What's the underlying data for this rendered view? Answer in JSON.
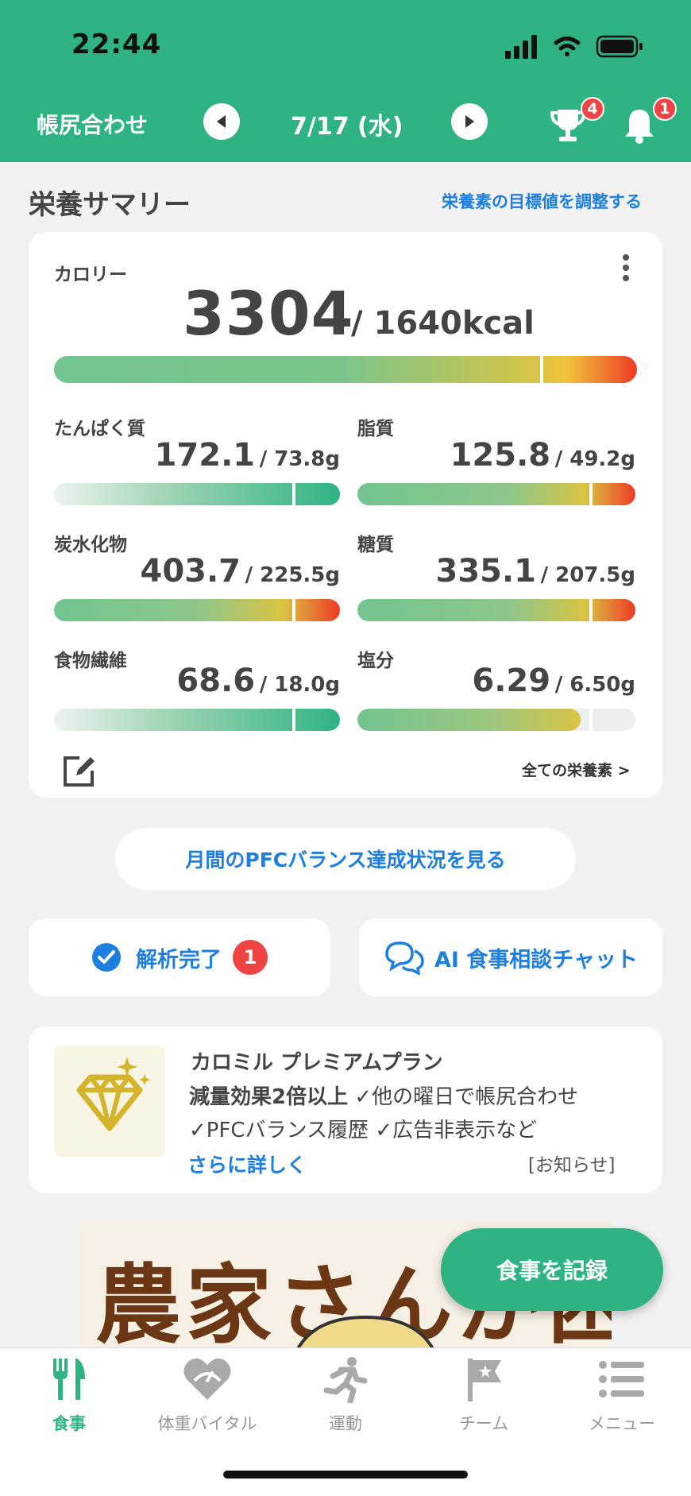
{
  "status": {
    "time": "22:44"
  },
  "nav": {
    "title": "帳尻合わせ",
    "date": "7/17 (水)",
    "trophy_badge": "4",
    "bell_badge": "1"
  },
  "summary": {
    "title": "栄養サマリー",
    "adjust_link": "栄養素の目標値を調整する"
  },
  "calorie": {
    "label": "カロリー",
    "value": "3304",
    "target": "/ 1640kcal"
  },
  "nutrients": [
    {
      "label": "たんぱく質",
      "value": "172.1",
      "target": "/ 73.8g"
    },
    {
      "label": "脂質",
      "value": "125.8",
      "target": "/ 49.2g"
    },
    {
      "label": "炭水化物",
      "value": "403.7",
      "target": "/ 225.5g"
    },
    {
      "label": "糖質",
      "value": "335.1",
      "target": "/ 207.5g"
    },
    {
      "label": "食物繊維",
      "value": "68.6",
      "target": "/ 18.0g"
    },
    {
      "label": "塩分",
      "value": "6.29",
      "target": "/ 6.50g"
    }
  ],
  "all_nutrients_link": "全ての栄養素 >",
  "pfc_button": "月間のPFCバランス達成状況を見る",
  "analysis": {
    "label": "解析完了",
    "badge": "1"
  },
  "ai_chat": {
    "label": "AI 食事相談チャット"
  },
  "promo": {
    "title": "カロミル プレミアムプラン",
    "line1_bold": "減量効果2倍以上",
    "line1_rest": "✓他の曜日で帳尻合わせ",
    "line2": "✓PFCバランス履歴 ✓広告非表示など",
    "more": "さらに詳しく",
    "notice": "[お知らせ]"
  },
  "ad": {
    "text": "農家さんが困"
  },
  "fab": "食事を記録",
  "tabs": [
    {
      "label": "食事",
      "icon": "fork-knife-icon"
    },
    {
      "label": "体重バイタル",
      "icon": "heart-scale-icon"
    },
    {
      "label": "運動",
      "icon": "runner-icon"
    },
    {
      "label": "チーム",
      "icon": "flag-icon"
    },
    {
      "label": "メニュー",
      "icon": "menu-list-icon"
    }
  ],
  "colors": {
    "brand": "#2fb383",
    "link": "#1d7fe0",
    "badge": "#ef4444"
  }
}
